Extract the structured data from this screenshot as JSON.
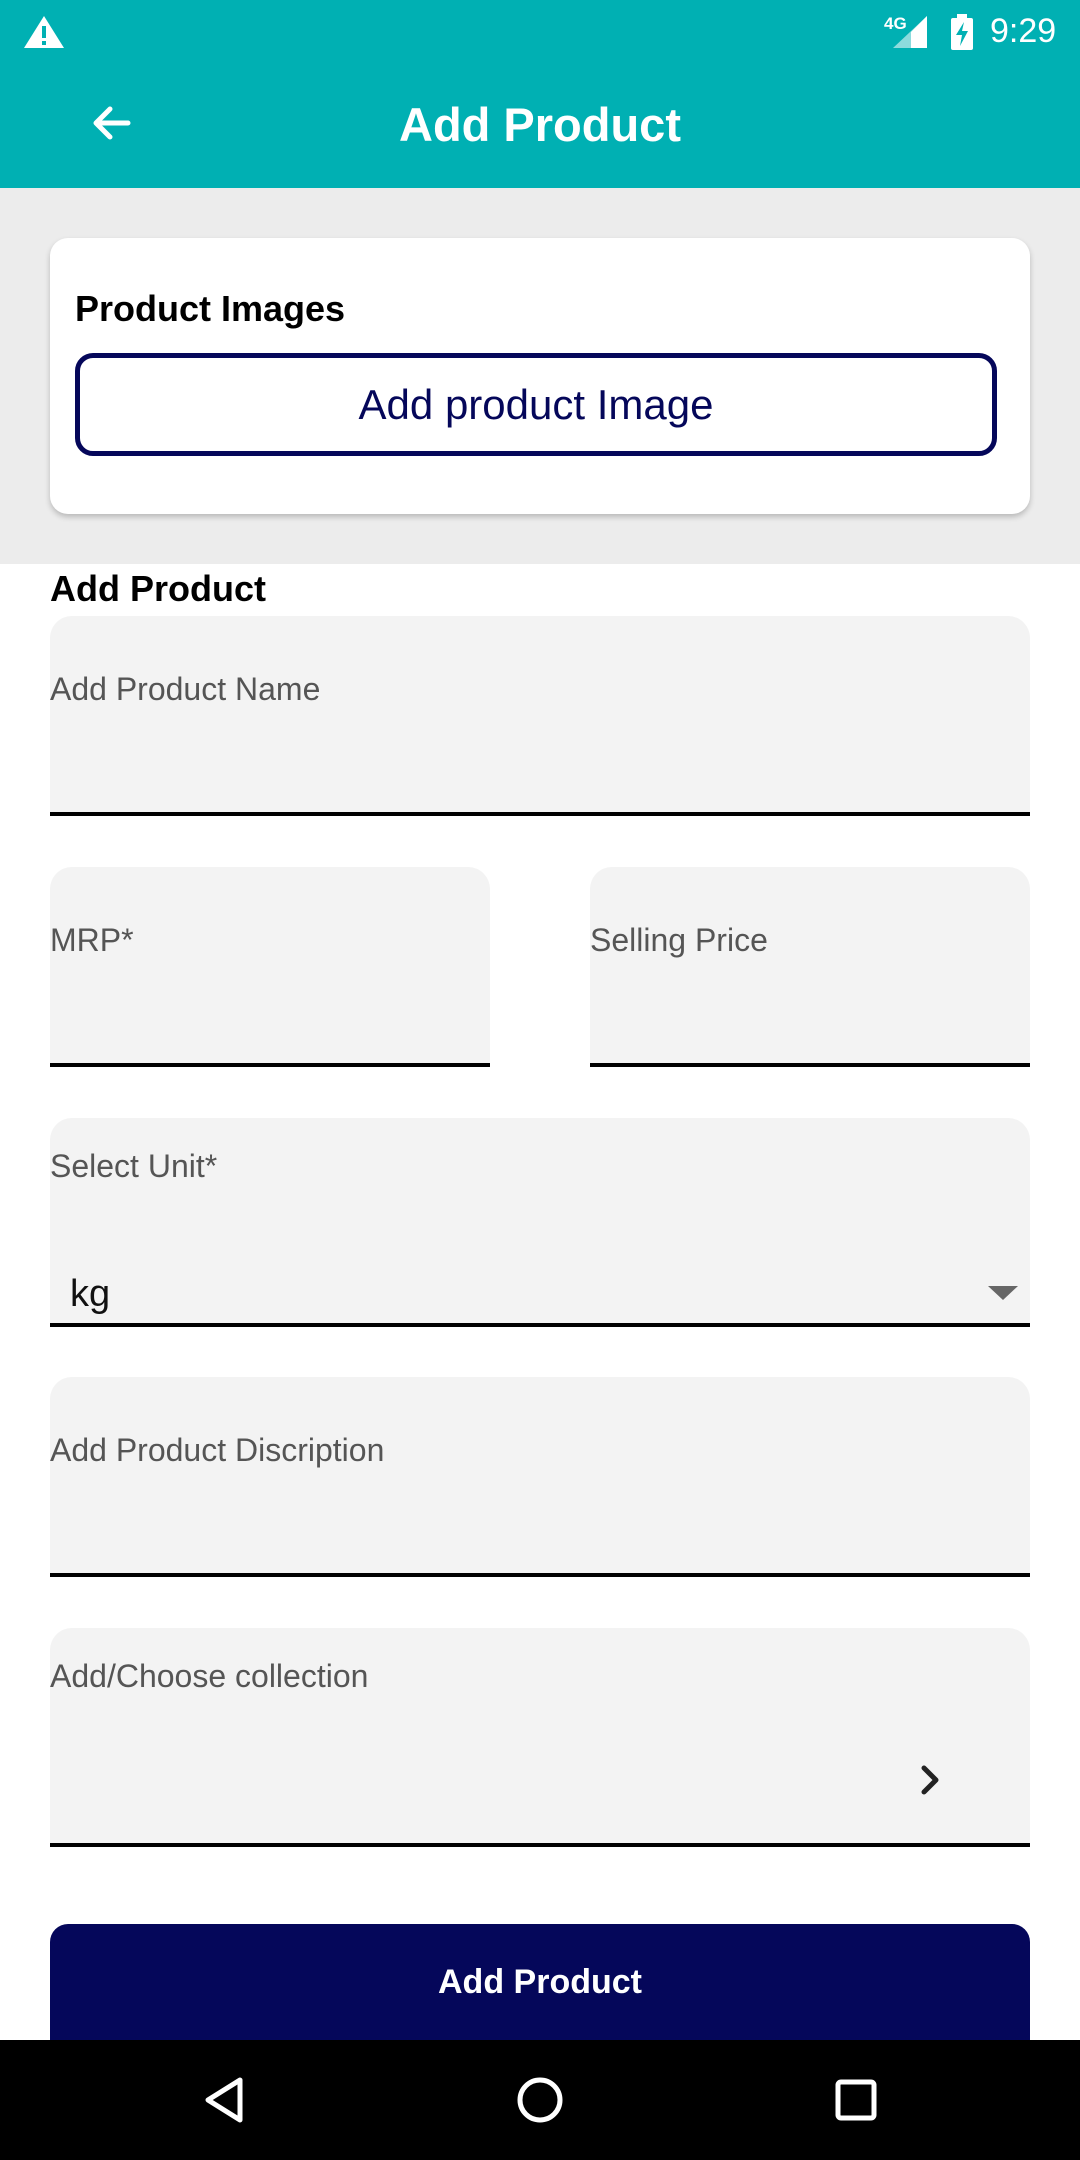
{
  "status_bar": {
    "network": "4G",
    "time": "9:29"
  },
  "app_bar": {
    "title": "Add Product",
    "back_icon": "arrow-left-icon"
  },
  "image_card": {
    "title": "Product Images",
    "button_label": "Add product Image"
  },
  "form": {
    "section_title": "Add Product",
    "product_name": {
      "label": "Add Product Name",
      "value": ""
    },
    "mrp": {
      "label": "MRP*",
      "value": ""
    },
    "selling_price": {
      "label": "Selling Price",
      "value": ""
    },
    "unit": {
      "label": "Select Unit*",
      "value": "kg"
    },
    "description": {
      "label": "Add Product Discription",
      "value": ""
    },
    "collection": {
      "label": "Add/Choose collection",
      "value": ""
    },
    "submit_label": "Add Product"
  },
  "colors": {
    "primary": "#00b0b3",
    "accent_dark": "#05075a",
    "field_bg": "#f3f3f3"
  },
  "nav_bar": {
    "icons": [
      "back-triangle-icon",
      "home-circle-icon",
      "recents-square-icon"
    ]
  }
}
